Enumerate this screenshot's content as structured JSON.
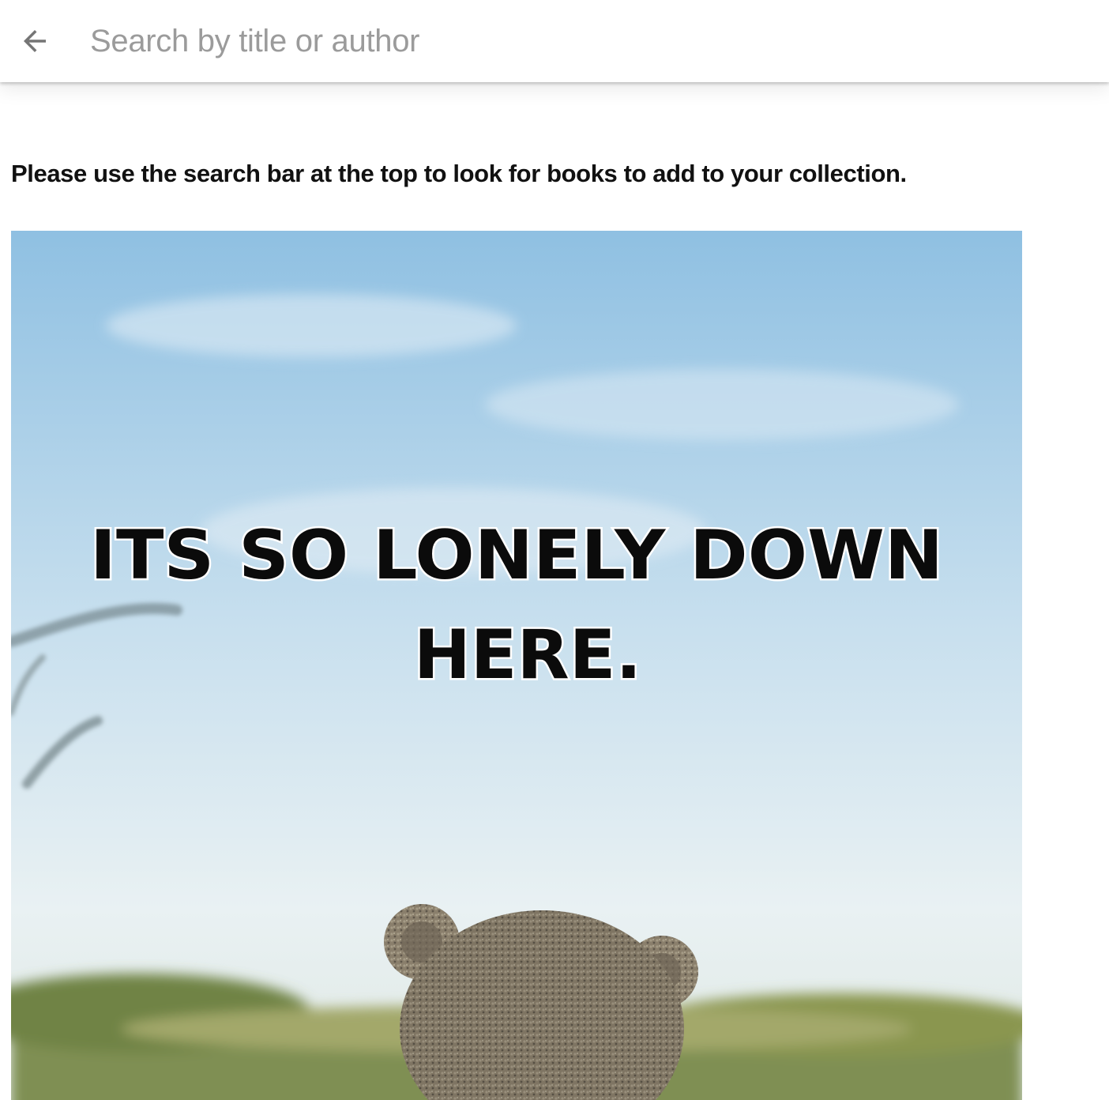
{
  "header": {
    "back_icon": "arrow-left-icon",
    "search_placeholder": "Search by title or author",
    "search_value": ""
  },
  "main": {
    "instructions": "Please use the search bar at the top to look for books to add to your collection.",
    "image": {
      "caption_line1": "ITS SO LONELY DOWN",
      "caption_line2": "HERE."
    }
  },
  "colors": {
    "placeholder_text": "#9b9b9b",
    "icon": "#757575",
    "sky_top": "#8fc0e2",
    "sky_bottom": "#eef3f4"
  }
}
